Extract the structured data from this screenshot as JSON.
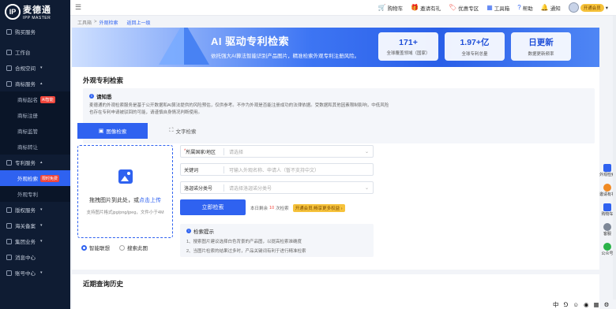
{
  "brand": {
    "mark": "IP",
    "name_cn": "麦德通",
    "name_en": "IPP MASTER"
  },
  "sidebar": {
    "items": [
      {
        "label": "购买服务",
        "type": "item"
      },
      {
        "label": "工作台",
        "type": "item"
      },
      {
        "label": "合规空间",
        "type": "item",
        "caret": "▾"
      },
      {
        "label": "商标服务",
        "type": "item",
        "caret": "▴"
      },
      {
        "label": "商标起名",
        "type": "sub",
        "badge": "AI智能"
      },
      {
        "label": "商标注册",
        "type": "sub"
      },
      {
        "label": "商标监管",
        "type": "sub"
      },
      {
        "label": "商标转让",
        "type": "sub"
      },
      {
        "label": "专利服务",
        "type": "item",
        "caret": "▴"
      },
      {
        "label": "外观检索",
        "type": "sub",
        "badge": "限时免费",
        "active": true
      },
      {
        "label": "外观专利",
        "type": "sub"
      },
      {
        "label": "版权服务",
        "type": "item",
        "caret": "▾"
      },
      {
        "label": "海关备案",
        "type": "item",
        "caret": "▾"
      },
      {
        "label": "集团业务",
        "type": "item",
        "caret": "▾"
      },
      {
        "label": "消息中心",
        "type": "item"
      },
      {
        "label": "账号中心",
        "type": "item",
        "caret": "▾"
      }
    ]
  },
  "topbar": {
    "menu_icon": "☰",
    "links": [
      {
        "label": "购物车",
        "icon": "🛒"
      },
      {
        "label": "邀请有礼",
        "icon": "🎁"
      },
      {
        "label": "优惠专区",
        "icon": "🏷"
      },
      {
        "label": "工具箱",
        "icon": "▦"
      },
      {
        "label": "帮助",
        "icon": "?"
      },
      {
        "label": "通知",
        "icon": "🔔"
      }
    ],
    "user_badge": "开通会员",
    "user_caret": "▾"
  },
  "breadcrumb": {
    "root": "工具箱",
    "sep": ">",
    "current": "外观检索",
    "back": "返回上一级"
  },
  "banner": {
    "title": "AI 驱动专利检索",
    "subtitle": "依托强大AI算法智能识别产品图片，精准检索外观专利注册风险。",
    "stats": [
      {
        "value": "171+",
        "label": "全球覆盖领域（国家）"
      },
      {
        "value": "1.97+亿",
        "label": "全球专利总量"
      },
      {
        "value": "日更新",
        "label": "数据更新频率"
      }
    ]
  },
  "page_title": "外观专利检索",
  "notice": {
    "title": "请知悉",
    "body": "麦德通的外观检索服务是基于公开数据和AI算法提供的风险预估，仅供参考。不作为外观是否能注册成功的法律依据。受数据和其他因素限制影响，中低风险也存在专利申请被驳回的可能，请谨慎自身情况判断使用。"
  },
  "tabs": [
    {
      "label": "图像检索",
      "icon": "▣",
      "active": true
    },
    {
      "label": "文字检索",
      "icon": "⛶",
      "active": false
    }
  ],
  "upload": {
    "text_prefix": "拖拽图片到此处，或",
    "link": "点击上传",
    "hint": "支持图片格式jpg/png/jpeg，文件小于4M"
  },
  "radios": [
    {
      "label": "智能联想",
      "checked": true
    },
    {
      "label": "搜索此图",
      "checked": false
    }
  ],
  "form": {
    "region": {
      "required": "*",
      "label": "所属国家/地区",
      "placeholder": "请选择"
    },
    "keyword": {
      "label": "关键词",
      "placeholder": "可输入外观名称、申请人（暂不支持中文）"
    },
    "classification": {
      "label": "洛迦诺分类号",
      "placeholder": "请选择洛迦诺分类号"
    }
  },
  "search_button": "立即检索",
  "remain": {
    "prefix": "本日剩余",
    "count": "10",
    "suffix": "次检索",
    "vip": "开通会员,畅享更多权益 ›"
  },
  "tips": {
    "title": "检索提示",
    "lines": [
      "1、搜索图片建议选择白色背景的产品图，以提高检索准确度",
      "2、当图片检索的结果过多时，产品关键词有利于进行精准检索"
    ]
  },
  "history_title": "近期查询历史",
  "right_bar": [
    {
      "label": "外观检索",
      "icon": "patent-icon"
    },
    {
      "label": "邀请有礼",
      "icon": "gift-icon"
    },
    {
      "label": "购物车",
      "icon": "cart-icon"
    },
    {
      "label": "客服",
      "icon": "service-icon"
    },
    {
      "label": "公众号",
      "icon": "wechat-icon"
    }
  ],
  "ime": [
    "中",
    "⅁",
    "☺",
    "◉",
    "▦",
    "⚙"
  ],
  "colors": {
    "primary": "#2f62f0",
    "sidebar": "#0f1c33",
    "danger": "#f0463c",
    "vip": "#f6c23b"
  }
}
